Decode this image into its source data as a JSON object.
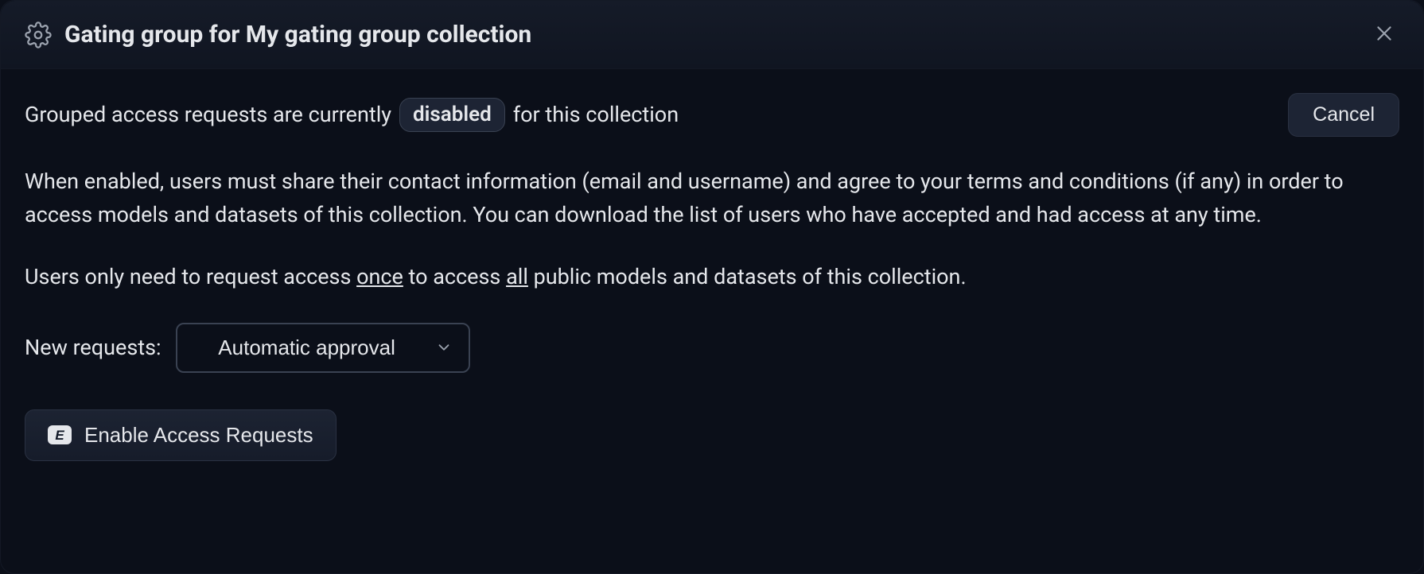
{
  "header": {
    "title": "Gating group for My gating group collection"
  },
  "status": {
    "prefix": "Grouped access requests are currently",
    "pill": "disabled",
    "suffix": "for this collection",
    "cancel_label": "Cancel"
  },
  "description": {
    "paragraph1": "When enabled, users must share their contact information (email and username) and agree to your terms and conditions (if any) in order to access models and datasets of this collection. You can download the list of users who have accepted and had access at any time.",
    "p2_pre": "Users only need to request access ",
    "p2_once": "once",
    "p2_mid": " to access ",
    "p2_all": "all",
    "p2_post": " public models and datasets of this collection."
  },
  "form": {
    "new_requests_label": "New requests:",
    "approval_selected": "Automatic approval"
  },
  "actions": {
    "enable_badge_letter": "E",
    "enable_label": "Enable Access Requests"
  }
}
